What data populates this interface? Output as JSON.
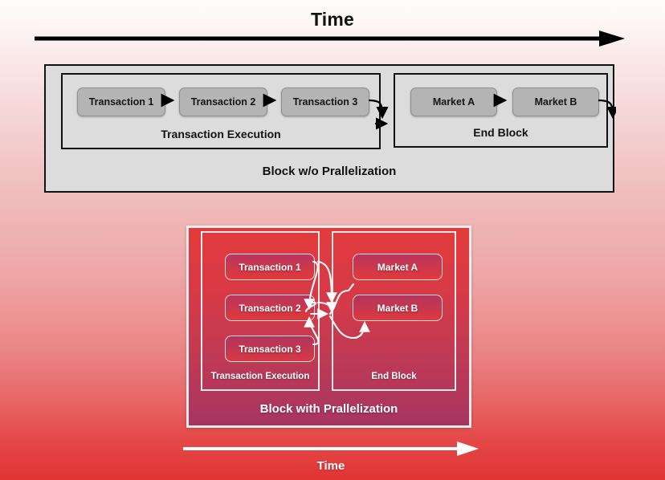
{
  "diagram": {
    "top_time_label": "Time",
    "bottom_time_label": "Time",
    "sequential_block": {
      "outer_label": "Block w/o Prallelization",
      "groups": [
        {
          "label": "Transaction Execution",
          "cards": [
            "Transaction 1",
            "Transaction 2",
            "Transaction 3"
          ]
        },
        {
          "label": "End Block",
          "cards": [
            "Market A",
            "Market B"
          ]
        }
      ]
    },
    "parallel_block": {
      "outer_label": "Block with Prallelization",
      "groups": [
        {
          "label": "Transaction Execution",
          "cards": [
            "Transaction 1",
            "Transaction 2",
            "Transaction 3"
          ]
        },
        {
          "label": "End Block",
          "cards": [
            "Market A",
            "Market B"
          ]
        }
      ]
    },
    "colors": {
      "background_top": "#fffdfd",
      "background_bottom": "#e03434",
      "sequential_block_fill": "#dcdcdc",
      "sequential_card_fill": "#b4b4b4",
      "sequential_outline": "#111111",
      "parallel_block_top": "#e23b3b",
      "parallel_block_bottom": "#a63560",
      "parallel_outline": "#f7eaea",
      "arrow_dark": "#000000",
      "arrow_light": "#ffffff"
    }
  }
}
